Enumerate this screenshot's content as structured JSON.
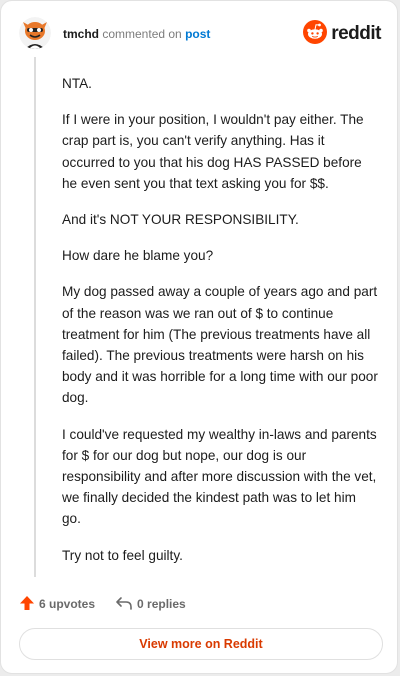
{
  "comment": {
    "username": "tmchd",
    "action_text": "commented on",
    "target_link": "post",
    "brand": "reddit",
    "paragraphs": [
      "NTA.",
      "If I were in your position, I wouldn't pay either. The crap part is, you can't verify anything. Has it occurred to you that his dog HAS PASSED before he even sent you that text asking you for $$.",
      "And it's NOT YOUR RESPONSIBILITY.",
      "How dare he blame you?",
      "My dog passed away a couple of years ago and part of the reason was we ran out of $ to continue treatment for him (The previous treatments have all failed). The previous treatments were harsh on his body and it was horrible for a long time with our poor dog.",
      "I could've requested my wealthy in-laws and parents for $ for our dog but nope, our dog is our responsibility and after more discussion with the vet, we finally decided the kindest path was to let him go.",
      "Try not to feel guilty."
    ],
    "upvotes_label": "6 upvotes",
    "replies_label": "0 replies",
    "view_more_label": "View more on Reddit"
  },
  "colors": {
    "brand_orange": "#ff4500",
    "link_blue": "#0079d3",
    "view_more_text": "#d93a00",
    "muted_text": "#6a6a6a"
  },
  "icons": {
    "avatar": "snoo-avatar",
    "brand_logo": "reddit-snoo-icon",
    "upvote": "arrow-up-icon",
    "reply": "reply-arrow-icon"
  }
}
